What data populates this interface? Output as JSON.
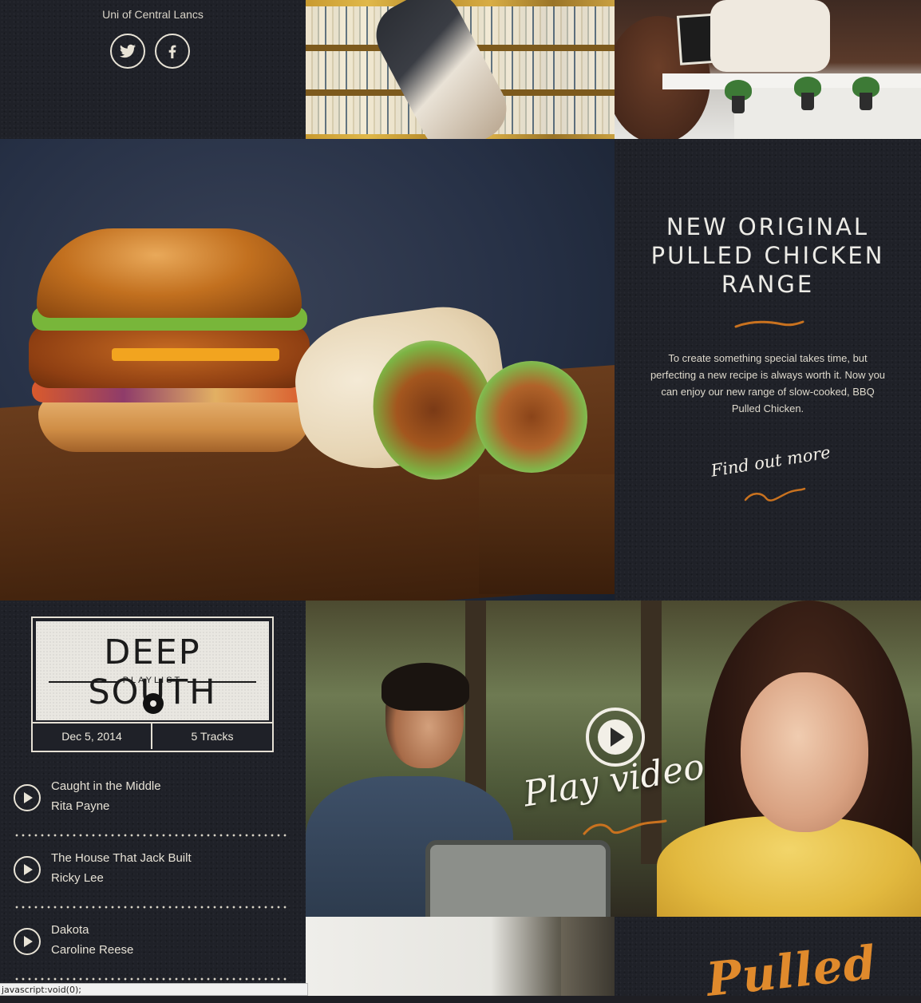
{
  "top": {
    "location": "Uni of Central Lancs",
    "social": [
      {
        "name": "twitter-icon"
      },
      {
        "name": "facebook-icon"
      }
    ]
  },
  "promo": {
    "title_lines": [
      "NEW ORIGINAL",
      "PULLED CHICKEN",
      "RANGE"
    ],
    "text": "To create something special takes time, but perfecting a new recipe is always worth it. Now you can enjoy our new range of slow-cooked, BBQ Pulled Chicken.",
    "cta": "Find out more",
    "accent_color": "#c9721f"
  },
  "playlist": {
    "title": "DEEP SOUTH",
    "subtitle": "PLAYLIST",
    "date": "Dec 5, 2014",
    "tracks_count": "5 Tracks",
    "tracks": [
      {
        "title": "Caught in the Middle",
        "artist": "Rita Payne"
      },
      {
        "title": "The House That Jack Built",
        "artist": "Ricky Lee"
      },
      {
        "title": "Dakota",
        "artist": "Caroline Reese"
      }
    ]
  },
  "video": {
    "label": "Play video"
  },
  "bottom": {
    "logo_text": "Pulled"
  },
  "status_bar": {
    "text": "javascript:void(0);"
  }
}
